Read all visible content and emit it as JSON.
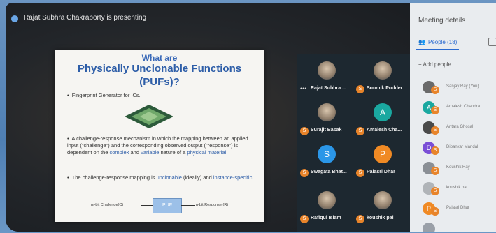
{
  "presenter": {
    "label": "Rajat Subhra Chakraborty is presenting"
  },
  "slide": {
    "title_line1": "What are",
    "title_line2": "Physically Unclonable Functions",
    "title_line3": "(PUFs)?",
    "bullet1": "Fingerprint Generator for ICs.",
    "bullet2_a": "A challenge-response mechanism in which the mapping between an applied input (\"challenge\") and the corresponding observed output (\"response\") is dependent on the ",
    "bullet2_complex": "complex",
    "bullet2_b": " and ",
    "bullet2_variable": "variable",
    "bullet2_c": " nature of a ",
    "bullet2_material": "physical material",
    "bullet3_a": "The challenge-response mapping is ",
    "bullet3_unclonable": "unclonable",
    "bullet3_b": " (ideally) and ",
    "bullet3_instance": "instance-specific",
    "diagram_input": "m-bit Challenge(C)",
    "diagram_box": "PUF",
    "diagram_output": "n-bit Response (R)"
  },
  "tiles": [
    {
      "name": "Rajat Subhra ...",
      "avatar_letter": "",
      "badge": "",
      "avatar_color": "#3a7bd5",
      "photo": true,
      "dots": true
    },
    {
      "name": "Soumik Podder",
      "avatar_letter": "",
      "badge": "S",
      "avatar_color": "#7a6a55",
      "photo": true,
      "dots": false
    },
    {
      "name": "Surajit Basak",
      "avatar_letter": "",
      "badge": "S",
      "avatar_color": "#6a6a6a",
      "photo": true,
      "dots": false
    },
    {
      "name": "Amalesh Cha...",
      "avatar_letter": "A",
      "badge": "S",
      "avatar_color": "#1aa8a0",
      "photo": false,
      "dots": false
    },
    {
      "name": "Swagata Bhat...",
      "avatar_letter": "S",
      "badge": "S",
      "avatar_color": "#2b97e8",
      "photo": false,
      "dots": false
    },
    {
      "name": "Palasri Dhar",
      "avatar_letter": "P",
      "badge": "S",
      "avatar_color": "#f08a24",
      "photo": false,
      "dots": false
    },
    {
      "name": "Rafiqul Islam",
      "avatar_letter": "",
      "badge": "S",
      "avatar_color": "#5a6a7a",
      "photo": true,
      "dots": false
    },
    {
      "name": "koushik pal",
      "avatar_letter": "",
      "badge": "S",
      "avatar_color": "#9aa0a8",
      "photo": true,
      "dots": false
    }
  ],
  "panel": {
    "title": "Meeting details",
    "people_tab": "People (18)",
    "add_people": "Add people",
    "people": [
      {
        "name": "Sanjay Ray (You)",
        "avatar_letter": "",
        "avatar_color": "#6a6a6a",
        "badge": "S"
      },
      {
        "name": "Amalesh Chandra ...",
        "avatar_letter": "A",
        "avatar_color": "#1aa8a0",
        "badge": "S"
      },
      {
        "name": "Antara Ghosal",
        "avatar_letter": "",
        "avatar_color": "#4a4a4a",
        "badge": "S"
      },
      {
        "name": "Dipankar Mandal",
        "avatar_letter": "D",
        "avatar_color": "#7a4fd6",
        "badge": "S"
      },
      {
        "name": "Koushik Ray",
        "avatar_letter": "",
        "avatar_color": "#8a8f95",
        "badge": "S"
      },
      {
        "name": "koushik pal",
        "avatar_letter": "",
        "avatar_color": "#b0b4b8",
        "badge": "S"
      },
      {
        "name": "Palasri Dhar",
        "avatar_letter": "P",
        "avatar_color": "#f08a24",
        "badge": "S"
      },
      {
        "name": "",
        "avatar_letter": "",
        "avatar_color": "#9aa0a8",
        "badge": ""
      }
    ]
  },
  "colors": {
    "accent": "#2a6ad0",
    "badge": "#e8842a",
    "slide_title": "#2e5ea8"
  }
}
